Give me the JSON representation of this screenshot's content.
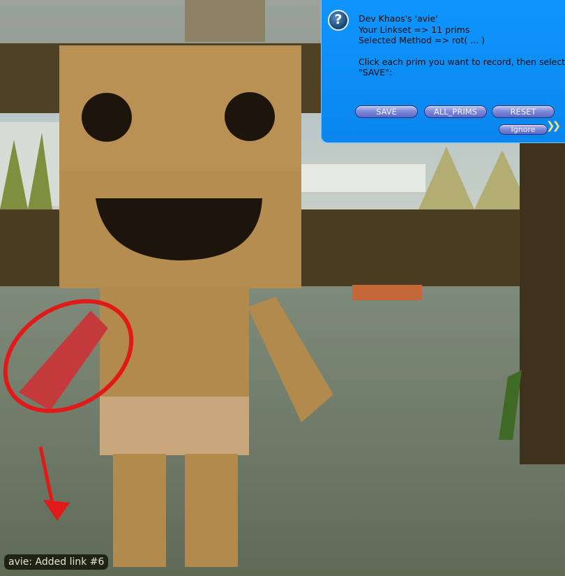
{
  "dialog": {
    "owner_line": "Dev Khaos's 'avie'",
    "linkset_line": "Your Linkset => 11 prims",
    "method_line": "Selected Method => rot( ... )",
    "instruction_line1": "Click each prim you want to record, then select",
    "instruction_line2": "\"SAVE\":",
    "buttons": {
      "save": "SAVE",
      "all_prims": "ALL_PRIMS",
      "reset": "RESET",
      "ignore": "Ignore"
    }
  },
  "status_bar": {
    "text": "avie: Added link #6"
  },
  "icons": {
    "help": "question-mark-icon",
    "more": "chevron-right-icon"
  },
  "colors": {
    "dialog_bg": "#0f95ff",
    "button": "#6e79cf",
    "annotation": "#e11919",
    "cardboard": "#b58e4f"
  }
}
